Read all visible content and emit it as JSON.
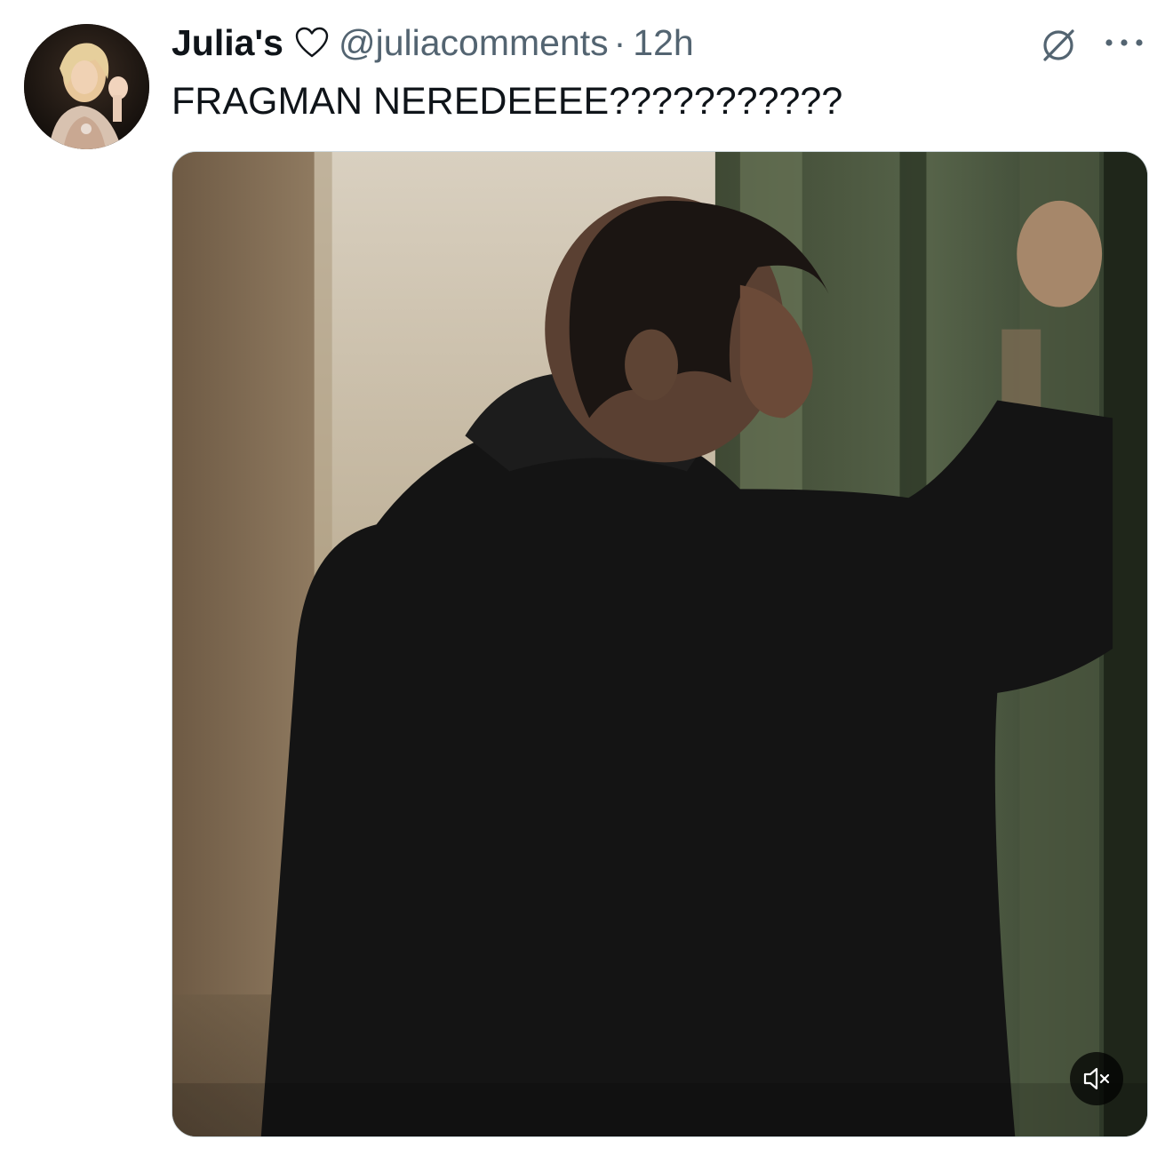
{
  "tweet": {
    "author": {
      "display_name": "Julia's",
      "handle": "@juliacomments",
      "avatar_icon": "avatar-photo"
    },
    "separator": "·",
    "timestamp": "12h",
    "text": "FRAGMAN NEREDEEEE???????????",
    "media": {
      "type": "video",
      "muted": true
    },
    "icons": {
      "verified_like": "heart-outline-icon",
      "grok": "grok-icon",
      "more": "more-options-icon",
      "mute": "volume-muted-icon"
    },
    "colors": {
      "text": "#0f1419",
      "secondary_text": "#536471",
      "border": "#cfd9de"
    }
  }
}
